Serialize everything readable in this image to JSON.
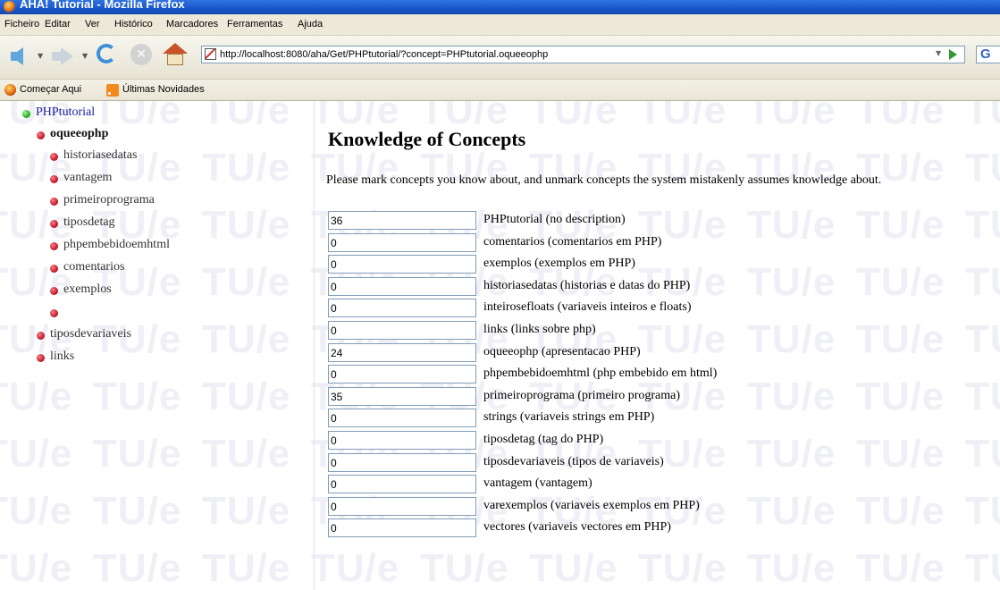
{
  "window": {
    "title": "AHA! Tutorial - Mozilla Firefox"
  },
  "menu": [
    "Ficheiro",
    "Editar",
    "Ver",
    "Histórico",
    "Marcadores",
    "Ferramentas",
    "Ajuda"
  ],
  "toolbar": {
    "url": "http://localhost:8080/aha/Get/PHPtutorial/?concept=PHPtutorial.oqueeophp",
    "search_stub": "G"
  },
  "bookmarks": [
    "Começar Aqui",
    "Últimas Novidades"
  ],
  "sidebar": {
    "items": [
      {
        "label": "PHPtutorial",
        "color": "#22b01a"
      },
      {
        "label": "oqueeophp",
        "color": "#c81d2c"
      },
      {
        "label": "historiasedatas",
        "color": "#c81d2c"
      },
      {
        "label": "vantagem",
        "color": "#c81d2c"
      },
      {
        "label": "primeiroprograma",
        "color": "#c81d2c"
      },
      {
        "label": "tiposdetag",
        "color": "#c81d2c"
      },
      {
        "label": "phpembebidoemhtml",
        "color": "#c81d2c"
      },
      {
        "label": "comentarios",
        "color": "#c81d2c"
      },
      {
        "label": "exemplos",
        "color": "#c81d2c"
      },
      {
        "label": "",
        "color": "#c81d2c"
      },
      {
        "label": "tiposdevariaveis",
        "color": "#c81d2c"
      },
      {
        "label": "links",
        "color": "#c81d2c"
      }
    ]
  },
  "main": {
    "heading": "Knowledge of Concepts",
    "instructions": "Please mark concepts you know about, and unmark concepts the system mistakenly assumes knowledge about.",
    "concepts": [
      {
        "value": "36",
        "label": "PHPtutorial (no description)"
      },
      {
        "value": "0",
        "label": "comentarios (comentarios em PHP)"
      },
      {
        "value": "0",
        "label": "exemplos (exemplos em PHP)"
      },
      {
        "value": "0",
        "label": "historiasedatas (historias e datas do PHP)"
      },
      {
        "value": "0",
        "label": "inteirosefloats (variaveis inteiros e floats)"
      },
      {
        "value": "0",
        "label": "links (links sobre php)"
      },
      {
        "value": "24",
        "label": "oqueeophp (apresentacao PHP)"
      },
      {
        "value": "0",
        "label": "phpembebidoemhtml (php embebido em html)"
      },
      {
        "value": "35",
        "label": "primeiroprograma (primeiro programa)"
      },
      {
        "value": "0",
        "label": "strings (variaveis strings em PHP)"
      },
      {
        "value": "0",
        "label": "tiposdetag (tag do PHP)"
      },
      {
        "value": "0",
        "label": "tiposdevariaveis (tipos de variaveis)"
      },
      {
        "value": "0",
        "label": "vantagem (vantagem)"
      },
      {
        "value": "0",
        "label": "varexemplos (variaveis exemplos em PHP)"
      },
      {
        "value": "0",
        "label": "vectores (variaveis vectores em PHP)"
      }
    ]
  }
}
